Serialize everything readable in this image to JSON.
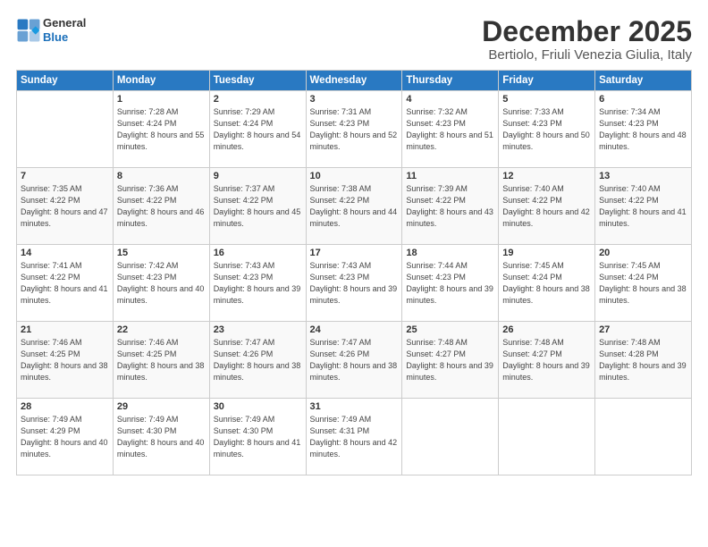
{
  "header": {
    "logo_general": "General",
    "logo_blue": "Blue",
    "month_title": "December 2025",
    "location": "Bertiolo, Friuli Venezia Giulia, Italy"
  },
  "days_of_week": [
    "Sunday",
    "Monday",
    "Tuesday",
    "Wednesday",
    "Thursday",
    "Friday",
    "Saturday"
  ],
  "weeks": [
    [
      {
        "day": "",
        "sunrise": "",
        "sunset": "",
        "daylight": ""
      },
      {
        "day": "1",
        "sunrise": "Sunrise: 7:28 AM",
        "sunset": "Sunset: 4:24 PM",
        "daylight": "Daylight: 8 hours and 55 minutes."
      },
      {
        "day": "2",
        "sunrise": "Sunrise: 7:29 AM",
        "sunset": "Sunset: 4:24 PM",
        "daylight": "Daylight: 8 hours and 54 minutes."
      },
      {
        "day": "3",
        "sunrise": "Sunrise: 7:31 AM",
        "sunset": "Sunset: 4:23 PM",
        "daylight": "Daylight: 8 hours and 52 minutes."
      },
      {
        "day": "4",
        "sunrise": "Sunrise: 7:32 AM",
        "sunset": "Sunset: 4:23 PM",
        "daylight": "Daylight: 8 hours and 51 minutes."
      },
      {
        "day": "5",
        "sunrise": "Sunrise: 7:33 AM",
        "sunset": "Sunset: 4:23 PM",
        "daylight": "Daylight: 8 hours and 50 minutes."
      },
      {
        "day": "6",
        "sunrise": "Sunrise: 7:34 AM",
        "sunset": "Sunset: 4:23 PM",
        "daylight": "Daylight: 8 hours and 48 minutes."
      }
    ],
    [
      {
        "day": "7",
        "sunrise": "Sunrise: 7:35 AM",
        "sunset": "Sunset: 4:22 PM",
        "daylight": "Daylight: 8 hours and 47 minutes."
      },
      {
        "day": "8",
        "sunrise": "Sunrise: 7:36 AM",
        "sunset": "Sunset: 4:22 PM",
        "daylight": "Daylight: 8 hours and 46 minutes."
      },
      {
        "day": "9",
        "sunrise": "Sunrise: 7:37 AM",
        "sunset": "Sunset: 4:22 PM",
        "daylight": "Daylight: 8 hours and 45 minutes."
      },
      {
        "day": "10",
        "sunrise": "Sunrise: 7:38 AM",
        "sunset": "Sunset: 4:22 PM",
        "daylight": "Daylight: 8 hours and 44 minutes."
      },
      {
        "day": "11",
        "sunrise": "Sunrise: 7:39 AM",
        "sunset": "Sunset: 4:22 PM",
        "daylight": "Daylight: 8 hours and 43 minutes."
      },
      {
        "day": "12",
        "sunrise": "Sunrise: 7:40 AM",
        "sunset": "Sunset: 4:22 PM",
        "daylight": "Daylight: 8 hours and 42 minutes."
      },
      {
        "day": "13",
        "sunrise": "Sunrise: 7:40 AM",
        "sunset": "Sunset: 4:22 PM",
        "daylight": "Daylight: 8 hours and 41 minutes."
      }
    ],
    [
      {
        "day": "14",
        "sunrise": "Sunrise: 7:41 AM",
        "sunset": "Sunset: 4:22 PM",
        "daylight": "Daylight: 8 hours and 41 minutes."
      },
      {
        "day": "15",
        "sunrise": "Sunrise: 7:42 AM",
        "sunset": "Sunset: 4:23 PM",
        "daylight": "Daylight: 8 hours and 40 minutes."
      },
      {
        "day": "16",
        "sunrise": "Sunrise: 7:43 AM",
        "sunset": "Sunset: 4:23 PM",
        "daylight": "Daylight: 8 hours and 39 minutes."
      },
      {
        "day": "17",
        "sunrise": "Sunrise: 7:43 AM",
        "sunset": "Sunset: 4:23 PM",
        "daylight": "Daylight: 8 hours and 39 minutes."
      },
      {
        "day": "18",
        "sunrise": "Sunrise: 7:44 AM",
        "sunset": "Sunset: 4:23 PM",
        "daylight": "Daylight: 8 hours and 39 minutes."
      },
      {
        "day": "19",
        "sunrise": "Sunrise: 7:45 AM",
        "sunset": "Sunset: 4:24 PM",
        "daylight": "Daylight: 8 hours and 38 minutes."
      },
      {
        "day": "20",
        "sunrise": "Sunrise: 7:45 AM",
        "sunset": "Sunset: 4:24 PM",
        "daylight": "Daylight: 8 hours and 38 minutes."
      }
    ],
    [
      {
        "day": "21",
        "sunrise": "Sunrise: 7:46 AM",
        "sunset": "Sunset: 4:25 PM",
        "daylight": "Daylight: 8 hours and 38 minutes."
      },
      {
        "day": "22",
        "sunrise": "Sunrise: 7:46 AM",
        "sunset": "Sunset: 4:25 PM",
        "daylight": "Daylight: 8 hours and 38 minutes."
      },
      {
        "day": "23",
        "sunrise": "Sunrise: 7:47 AM",
        "sunset": "Sunset: 4:26 PM",
        "daylight": "Daylight: 8 hours and 38 minutes."
      },
      {
        "day": "24",
        "sunrise": "Sunrise: 7:47 AM",
        "sunset": "Sunset: 4:26 PM",
        "daylight": "Daylight: 8 hours and 38 minutes."
      },
      {
        "day": "25",
        "sunrise": "Sunrise: 7:48 AM",
        "sunset": "Sunset: 4:27 PM",
        "daylight": "Daylight: 8 hours and 39 minutes."
      },
      {
        "day": "26",
        "sunrise": "Sunrise: 7:48 AM",
        "sunset": "Sunset: 4:27 PM",
        "daylight": "Daylight: 8 hours and 39 minutes."
      },
      {
        "day": "27",
        "sunrise": "Sunrise: 7:48 AM",
        "sunset": "Sunset: 4:28 PM",
        "daylight": "Daylight: 8 hours and 39 minutes."
      }
    ],
    [
      {
        "day": "28",
        "sunrise": "Sunrise: 7:49 AM",
        "sunset": "Sunset: 4:29 PM",
        "daylight": "Daylight: 8 hours and 40 minutes."
      },
      {
        "day": "29",
        "sunrise": "Sunrise: 7:49 AM",
        "sunset": "Sunset: 4:30 PM",
        "daylight": "Daylight: 8 hours and 40 minutes."
      },
      {
        "day": "30",
        "sunrise": "Sunrise: 7:49 AM",
        "sunset": "Sunset: 4:30 PM",
        "daylight": "Daylight: 8 hours and 41 minutes."
      },
      {
        "day": "31",
        "sunrise": "Sunrise: 7:49 AM",
        "sunset": "Sunset: 4:31 PM",
        "daylight": "Daylight: 8 hours and 42 minutes."
      },
      {
        "day": "",
        "sunrise": "",
        "sunset": "",
        "daylight": ""
      },
      {
        "day": "",
        "sunrise": "",
        "sunset": "",
        "daylight": ""
      },
      {
        "day": "",
        "sunrise": "",
        "sunset": "",
        "daylight": ""
      }
    ]
  ]
}
